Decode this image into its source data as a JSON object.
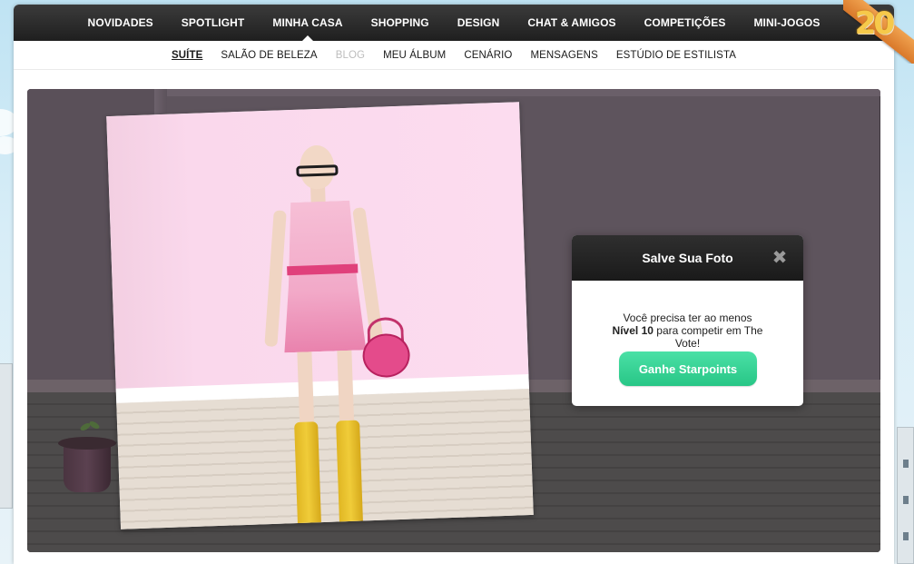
{
  "topnav": {
    "items": [
      {
        "label": "NOVIDADES"
      },
      {
        "label": "SPOTLIGHT"
      },
      {
        "label": "MINHA CASA",
        "active": true
      },
      {
        "label": "SHOPPING"
      },
      {
        "label": "DESIGN"
      },
      {
        "label": "CHAT & AMIGOS"
      },
      {
        "label": "COMPETIÇÕES"
      },
      {
        "label": "MINI-JOGOS"
      }
    ],
    "badge": "20"
  },
  "subnav": {
    "items": [
      {
        "label": "SUÍTE",
        "active": true
      },
      {
        "label": "SALÃO DE BELEZA"
      },
      {
        "label": "BLOG",
        "disabled": true
      },
      {
        "label": "MEU ÁLBUM"
      },
      {
        "label": "CENÁRIO"
      },
      {
        "label": "MENSAGENS"
      },
      {
        "label": "ESTÚDIO DE ESTILISTA"
      }
    ]
  },
  "modal": {
    "title": "Salve Sua Foto",
    "close_icon": "close-icon",
    "message_prefix": "Você precisa ter ao menos",
    "level_text": "Nível 10",
    "message_suffix": "para competir em The Vote!",
    "button_label": "Ganhe Starpoints"
  },
  "colors": {
    "nav_bg": "#1f1f1f",
    "cta_green": "#2fd08f",
    "stage_wall": "#5e545d"
  }
}
